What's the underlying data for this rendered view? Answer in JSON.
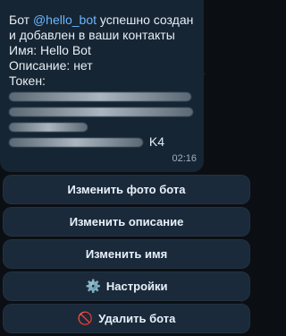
{
  "message": {
    "line1_prefix": "Бот ",
    "mention": "@hello_bot",
    "line1_suffix": " успешно создан",
    "line2": "и добавлен в ваши контакты",
    "line3": "Имя: Hello Bot",
    "line4": "Описание: нет",
    "line5": "Токен:",
    "token_visible_end": "K4",
    "time": "02:16"
  },
  "buttons": [
    {
      "label": "Изменить фото бота",
      "icon_text": ""
    },
    {
      "label": "Изменить описание",
      "icon_text": ""
    },
    {
      "label": "Изменить имя",
      "icon_text": ""
    },
    {
      "label": "Настройки",
      "icon_text": "⚙️"
    },
    {
      "label": "Удалить бота",
      "icon_text": "🚫"
    }
  ],
  "icons": {
    "settings": "gear-icon",
    "delete": "no-entry-icon"
  }
}
